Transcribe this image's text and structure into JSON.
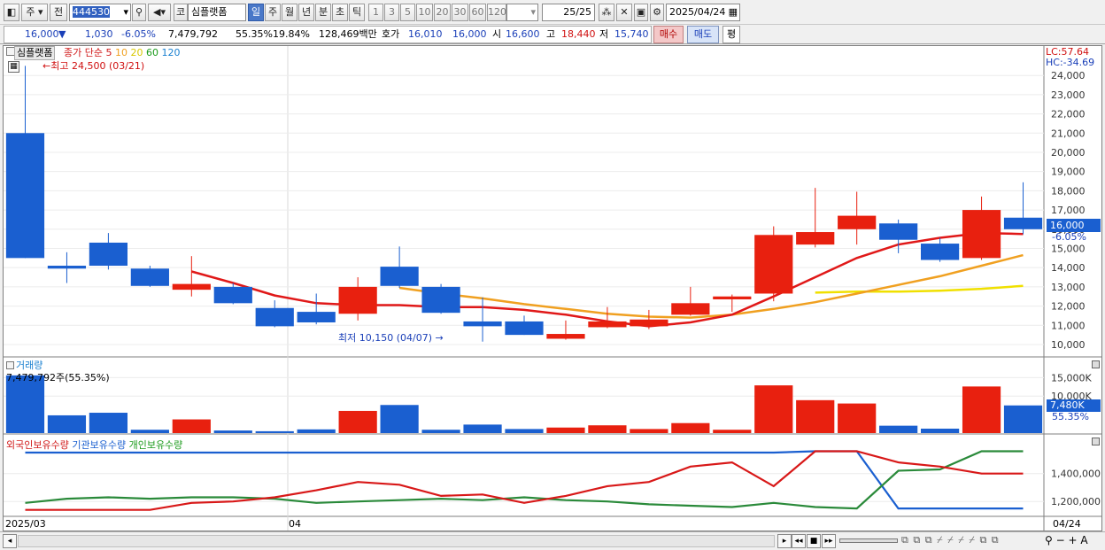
{
  "toolbar": {
    "market_label": "주",
    "prev_label": "전",
    "code": "444530",
    "stock_prefix": "코",
    "stock_name": "심플랫폼",
    "periods": [
      "일",
      "주",
      "월",
      "년",
      "분",
      "초",
      "틱"
    ],
    "active_period": "일",
    "intervals": [
      "1",
      "3",
      "5",
      "10",
      "20",
      "30",
      "60",
      "120"
    ],
    "count": "25",
    "count_total": "/25",
    "date": "2025/04/24"
  },
  "quote": {
    "price": "16,000",
    "arrow": "▼",
    "change": "1,030",
    "change_pct": "-6.05%",
    "volume": "7,479,792",
    "vol_ratio": "55.35%",
    "turnover": "19.84%",
    "amount": "128,469백만",
    "bid_label": "호가",
    "bid": "16,010",
    "ask": "16,000",
    "open_label": "시",
    "open": "16,600",
    "high_label": "고",
    "high": "18,440",
    "low_label": "저",
    "low": "15,740",
    "buy_label": "매수",
    "sell_label": "매도",
    "avg_label": "평"
  },
  "price_pane": {
    "name_tag": "심플랫폼",
    "ma_title": "종가 단순 5",
    "ma_periods": [
      "10",
      "20",
      "60",
      "120"
    ],
    "high_note": "←최고 24,500 (03/21)",
    "low_note": "최저 10,150 (04/07)",
    "low_arrow": "→",
    "lc_label": "LC:57.64",
    "hc_label": "HC:-34.69",
    "current_price": "16,000",
    "current_pct": "-6.05%",
    "ticks": [
      "24,000",
      "23,000",
      "22,000",
      "21,000",
      "20,000",
      "19,000",
      "18,000",
      "17,000",
      "16,000",
      "15,000",
      "14,000",
      "13,000",
      "12,000",
      "11,000",
      "10,000"
    ]
  },
  "volume_pane": {
    "title": "거래량",
    "info": "7,479,792주(55.35%)",
    "ticks": [
      "15,000K",
      "10,000K"
    ],
    "current": "7,480K",
    "current_pct": "55.35%"
  },
  "holding_pane": {
    "legend": [
      "외국인보유수량",
      "기관보유수량",
      "개인보유수량"
    ],
    "ticks": [
      "1,400,000",
      "1,200,000"
    ]
  },
  "date_axis": {
    "left": "2025/03",
    "mid": "04",
    "right": "04/24"
  },
  "colors": {
    "up": "#e8200f",
    "down": "#1a5fd0",
    "ma5": "#e01818",
    "ma10": "#f0a020",
    "ma20": "#f0e000",
    "ma60": "#1aa01a",
    "ma120": "#1a80d0"
  },
  "chart_data": {
    "type": "candlestick",
    "candles": [
      {
        "o": 21000,
        "h": 24500,
        "l": 14500,
        "c": 14500
      },
      {
        "o": 14100,
        "h": 14800,
        "l": 13200,
        "c": 13950
      },
      {
        "o": 15300,
        "h": 15800,
        "l": 13900,
        "c": 14100
      },
      {
        "o": 13950,
        "h": 14100,
        "l": 13000,
        "c": 13050
      },
      {
        "o": 12850,
        "h": 14600,
        "l": 12500,
        "c": 13150
      },
      {
        "o": 13000,
        "h": 13200,
        "l": 12100,
        "c": 12150
      },
      {
        "o": 11900,
        "h": 12300,
        "l": 10900,
        "c": 10950
      },
      {
        "o": 11700,
        "h": 12650,
        "l": 11050,
        "c": 11150
      },
      {
        "o": 11600,
        "h": 13500,
        "l": 11250,
        "c": 13000
      },
      {
        "o": 14050,
        "h": 15100,
        "l": 12950,
        "c": 13050
      },
      {
        "o": 13000,
        "h": 13150,
        "l": 11600,
        "c": 11650
      },
      {
        "o": 11200,
        "h": 12450,
        "l": 10150,
        "c": 10950
      },
      {
        "o": 11200,
        "h": 11500,
        "l": 10500,
        "c": 10500
      },
      {
        "o": 10300,
        "h": 11250,
        "l": 10250,
        "c": 10550
      },
      {
        "o": 10900,
        "h": 11950,
        "l": 10850,
        "c": 11200
      },
      {
        "o": 10950,
        "h": 11800,
        "l": 10800,
        "c": 11300
      },
      {
        "o": 11550,
        "h": 13000,
        "l": 11500,
        "c": 12150
      },
      {
        "o": 12350,
        "h": 12600,
        "l": 11700,
        "c": 12500
      },
      {
        "o": 12650,
        "h": 16150,
        "l": 12250,
        "c": 15700
      },
      {
        "o": 15200,
        "h": 18150,
        "l": 15050,
        "c": 15850
      },
      {
        "o": 16000,
        "h": 17950,
        "l": 15200,
        "c": 16700
      },
      {
        "o": 16300,
        "h": 16500,
        "l": 14750,
        "c": 15450
      },
      {
        "o": 15250,
        "h": 15550,
        "l": 14300,
        "c": 14400
      },
      {
        "o": 14500,
        "h": 17700,
        "l": 14400,
        "c": 17000
      },
      {
        "o": 16600,
        "h": 18440,
        "l": 15740,
        "c": 16000
      }
    ],
    "ma5": [
      null,
      null,
      null,
      null,
      13800,
      13200,
      12550,
      12150,
      12050,
      12050,
      11950,
      11950,
      11800,
      11550,
      11200,
      10950,
      11150,
      11550,
      12500,
      13500,
      14500,
      15200,
      15550,
      15800,
      15750
    ],
    "ma10": [
      null,
      null,
      null,
      null,
      null,
      null,
      null,
      null,
      null,
      12950,
      12650,
      12400,
      12100,
      11850,
      11600,
      11450,
      11400,
      11550,
      11850,
      12200,
      12650,
      13100,
      13550,
      14100,
      14650
    ],
    "ma20": [
      null,
      null,
      null,
      null,
      null,
      null,
      null,
      null,
      null,
      null,
      null,
      null,
      null,
      null,
      null,
      null,
      null,
      null,
      null,
      12700,
      12750,
      12750,
      12800,
      12900,
      13050
    ],
    "volume_k": [
      15600,
      4800,
      5500,
      900,
      3700,
      700,
      500,
      1000,
      6000,
      7600,
      900,
      2300,
      1100,
      1500,
      2100,
      1100,
      2700,
      900,
      12900,
      8900,
      8000,
      2000,
      1200,
      12600,
      7480
    ],
    "foreign": [
      1140000,
      1140000,
      1140000,
      1140000,
      1190000,
      1200000,
      1230000,
      1280000,
      1340000,
      1320000,
      1240000,
      1250000,
      1190000,
      1240000,
      1310000,
      1340000,
      1450000,
      1480000,
      1310000,
      1560000,
      1560000,
      1480000,
      1450000,
      1400000,
      1400000
    ],
    "institution": [
      1550000,
      1550000,
      1550000,
      1550000,
      1550000,
      1550000,
      1550000,
      1550000,
      1550000,
      1550000,
      1550000,
      1550000,
      1550000,
      1550000,
      1550000,
      1550000,
      1550000,
      1550000,
      1550000,
      1560000,
      1560000,
      1150000,
      1150000,
      1150000,
      1150000
    ],
    "individual": [
      1190000,
      1220000,
      1230000,
      1220000,
      1230000,
      1230000,
      1220000,
      1190000,
      1200000,
      1210000,
      1220000,
      1210000,
      1230000,
      1210000,
      1200000,
      1180000,
      1170000,
      1160000,
      1190000,
      1160000,
      1150000,
      1420000,
      1430000,
      1560000,
      1560000
    ],
    "ylim_price": [
      9400,
      24700
    ],
    "ylim_volume_k": [
      0,
      17000
    ],
    "ylim_holding": [
      1100000,
      1620000
    ]
  }
}
